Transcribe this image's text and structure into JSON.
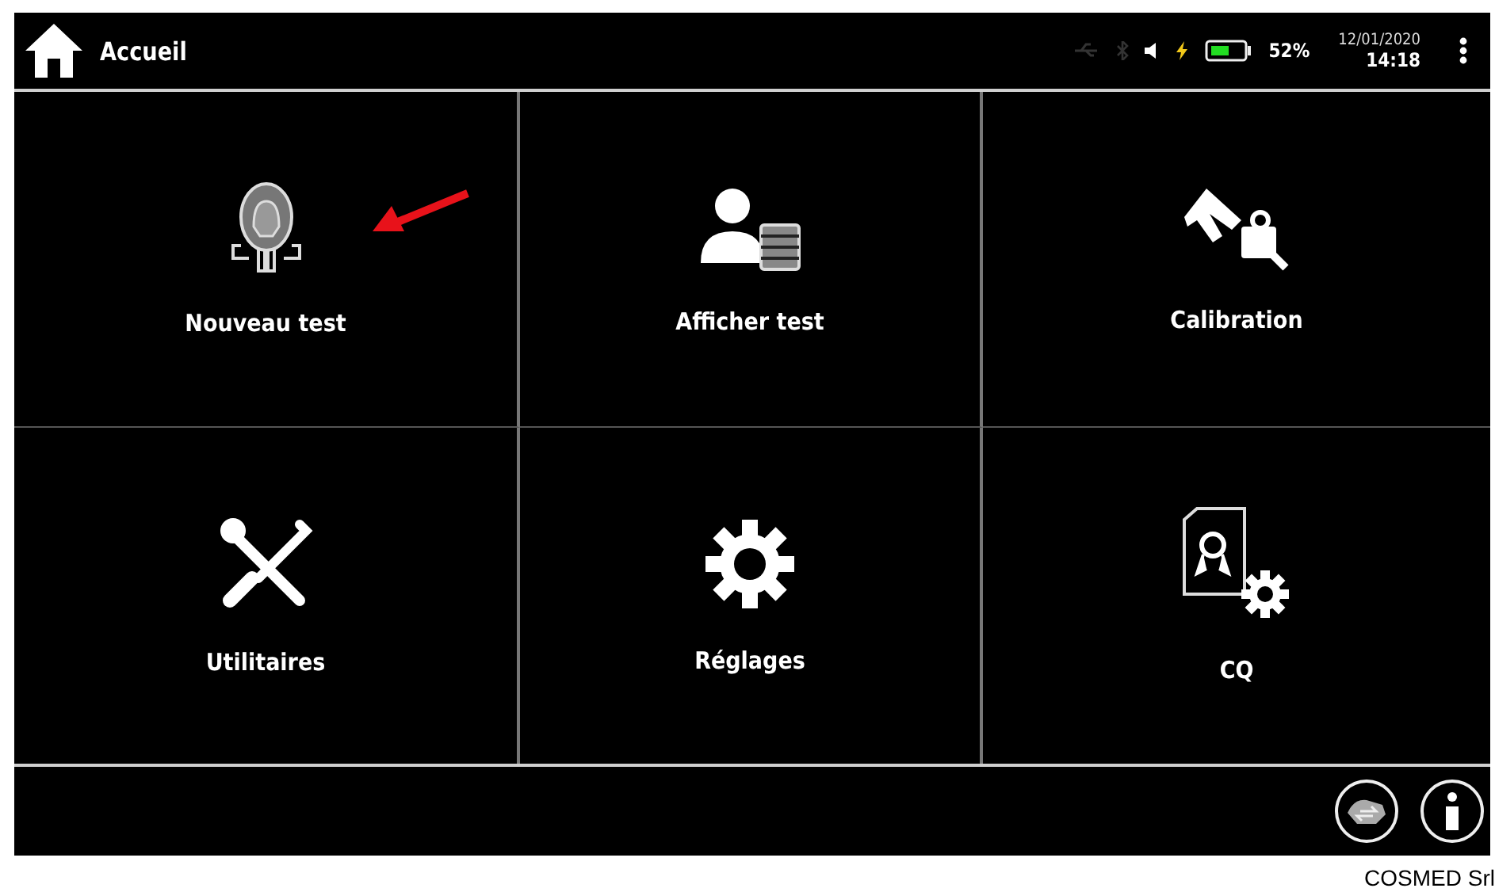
{
  "header": {
    "title": "Accueil",
    "status_icons": [
      {
        "kind": "usb",
        "active": false
      },
      {
        "kind": "bluetooth",
        "active": false
      },
      {
        "kind": "speaker",
        "active": true
      },
      {
        "kind": "charging",
        "active": true
      }
    ],
    "battery": "52%",
    "date": "12/01/2020",
    "time": "14:18"
  },
  "tiles": [
    {
      "label": "Nouveau test",
      "kind": "patient",
      "highlighted": true
    },
    {
      "label": "Afficher test",
      "kind": "records",
      "highlighted": false
    },
    {
      "label": "Calibration",
      "kind": "calibration",
      "highlighted": false
    },
    {
      "label": "Utilitaires",
      "kind": "tools",
      "highlighted": false
    },
    {
      "label": "Réglages",
      "kind": "settings",
      "highlighted": false
    },
    {
      "label": "CQ",
      "kind": "qc",
      "highlighted": false
    }
  ],
  "footer_buttons": [
    {
      "kind": "transfer"
    },
    {
      "kind": "info"
    }
  ],
  "caption": "COSMED Srl"
}
